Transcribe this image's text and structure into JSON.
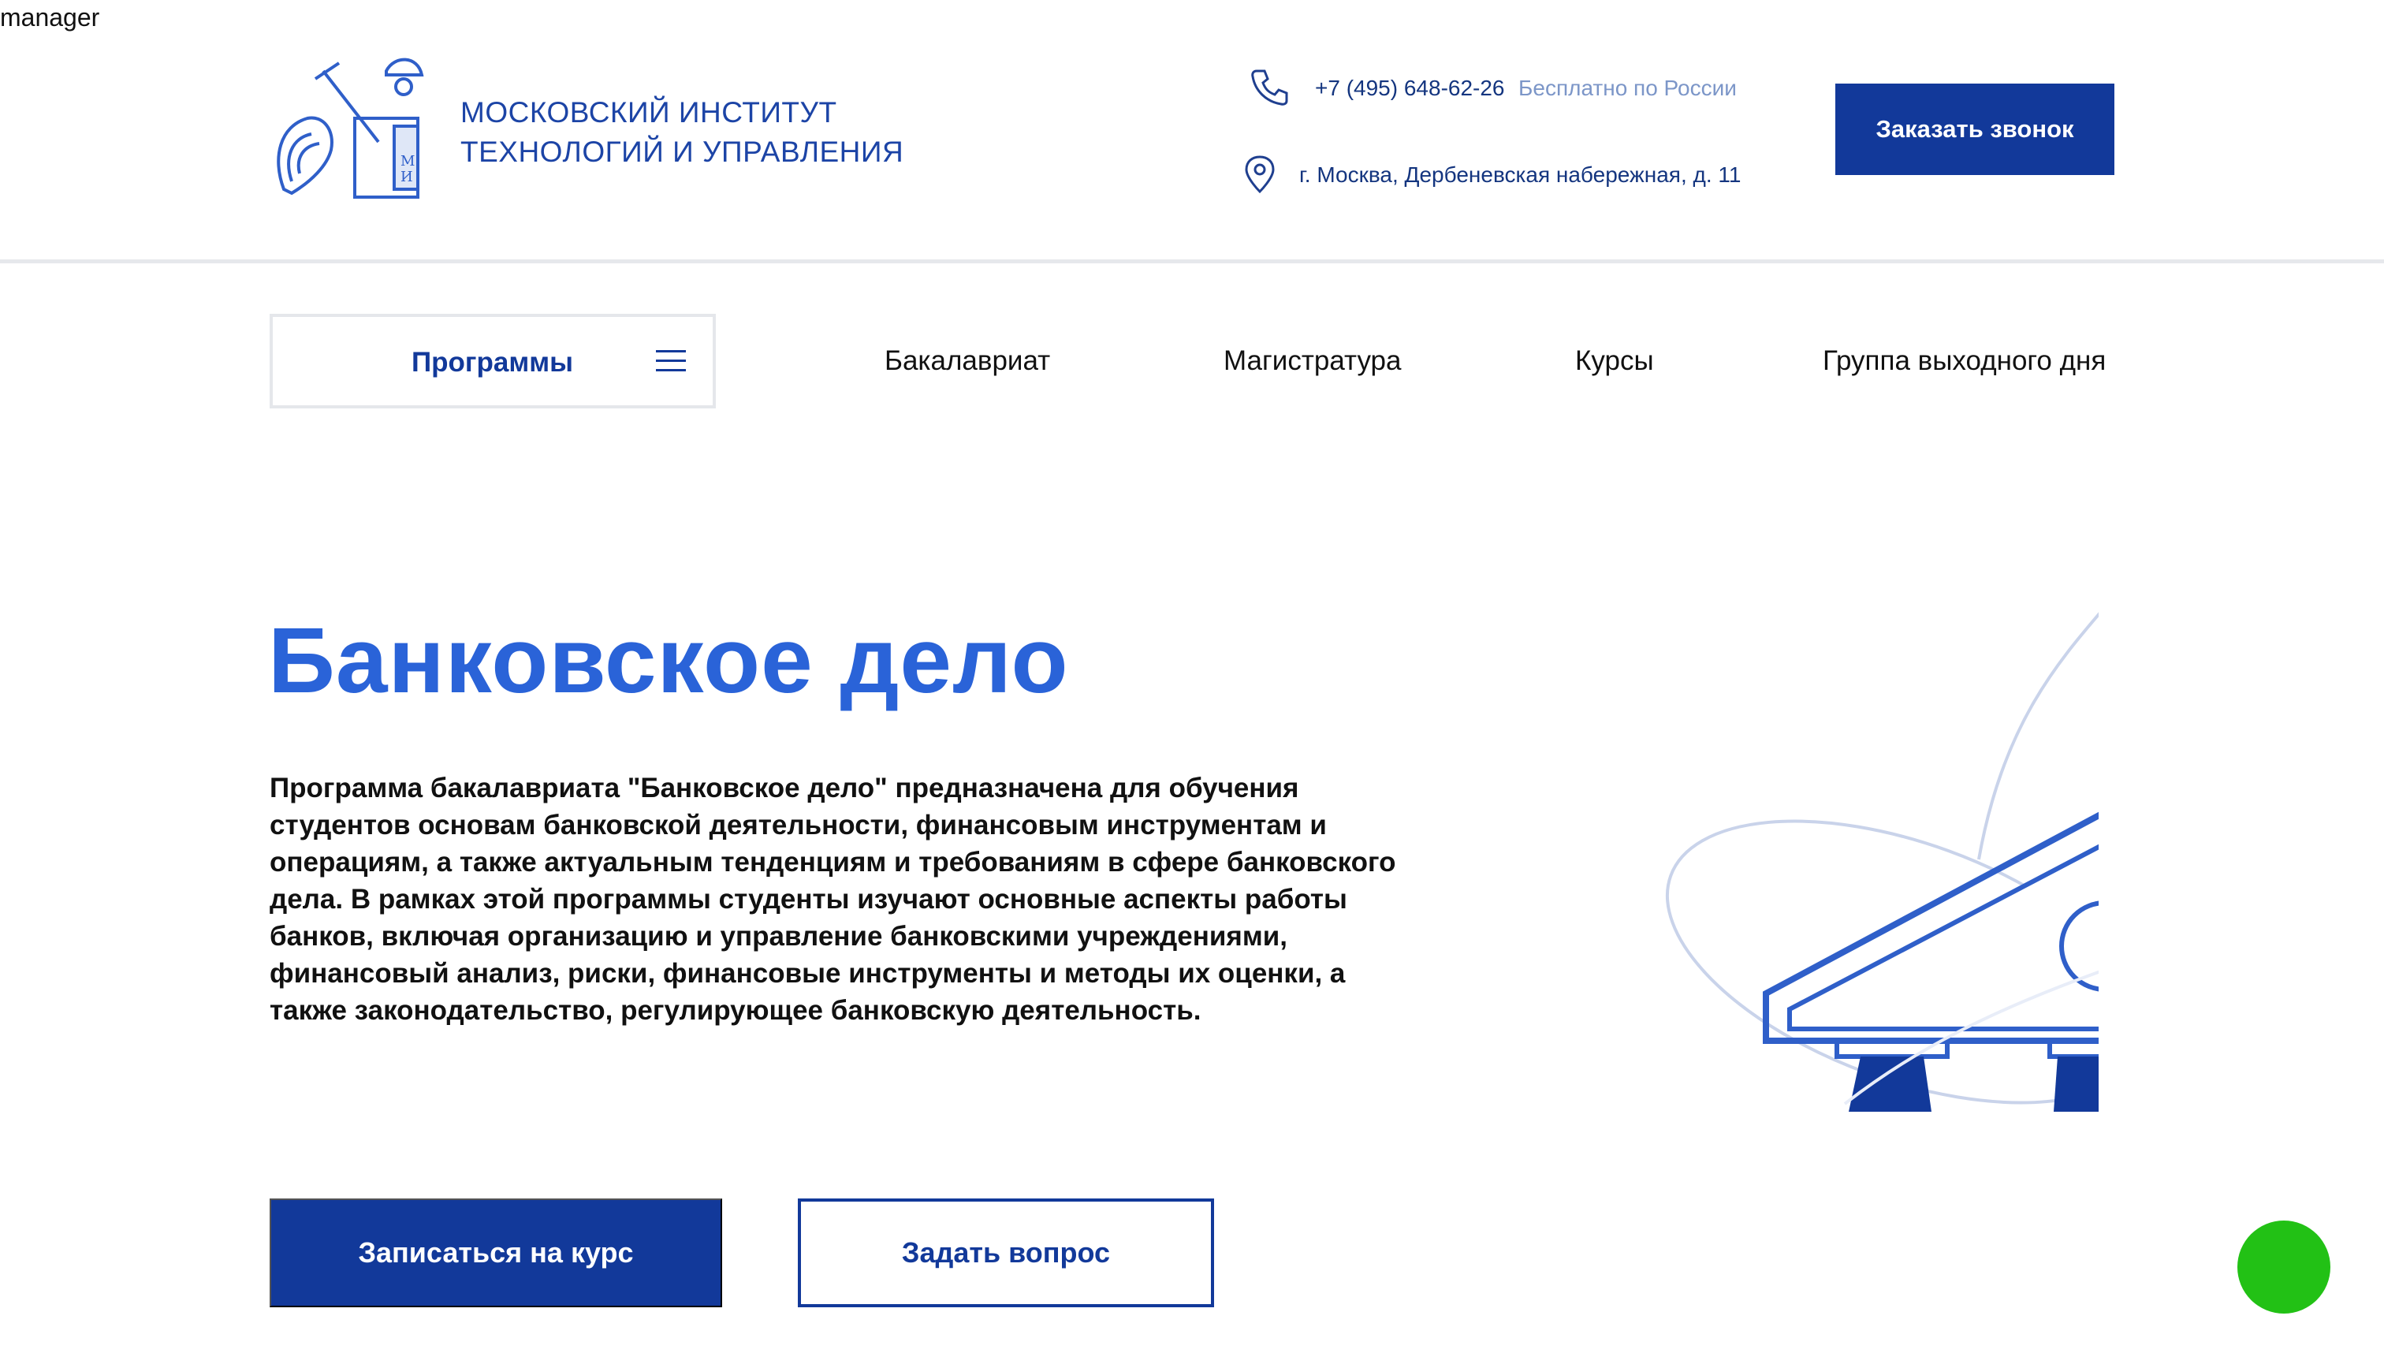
{
  "overlay": {
    "text": "manager"
  },
  "header": {
    "logo_icon": "institute-coat-of-arms-logo",
    "institute_name_line1": "МОСКОВСКИЙ ИНСТИТУТ",
    "institute_name_line2": "ТЕХНОЛОГИЙ И УПРАВЛЕНИЯ",
    "phone": "+7 (495) 648-62-26",
    "phone_note": "Бесплатно по России",
    "address": "г. Москва, Дербеневская набережная, д. 11",
    "call_button": "Заказать звонок"
  },
  "nav": {
    "programs": "Программы",
    "items": [
      "Бакалавриат",
      "Магистратура",
      "Курсы",
      "Группа выходного дня"
    ]
  },
  "hero": {
    "title": "Банковское дело",
    "description": "Программа бакалавриата \"Банковское дело\" предназначена для обучения студентов основам банковской деятельности, финансовым инструментам и операциям, а также актуальным тенденциям и требованиям в сфере банковского дела. В рамках этой программы студенты изучают основные аспекты работы банков, включая организацию и управление банковскими учреждениями, финансовый анализ, риски, финансовые инструменты и методы их оценки, а также законодательство, регулирующее банковскую деятельность.",
    "enroll_button": "Записаться на курс",
    "ask_button": "Задать вопрос"
  },
  "colors": {
    "brand_dark": "#12399a",
    "brand_title": "#2a63d8",
    "muted_blue": "#7c96c8",
    "chat_green": "#22c115"
  }
}
